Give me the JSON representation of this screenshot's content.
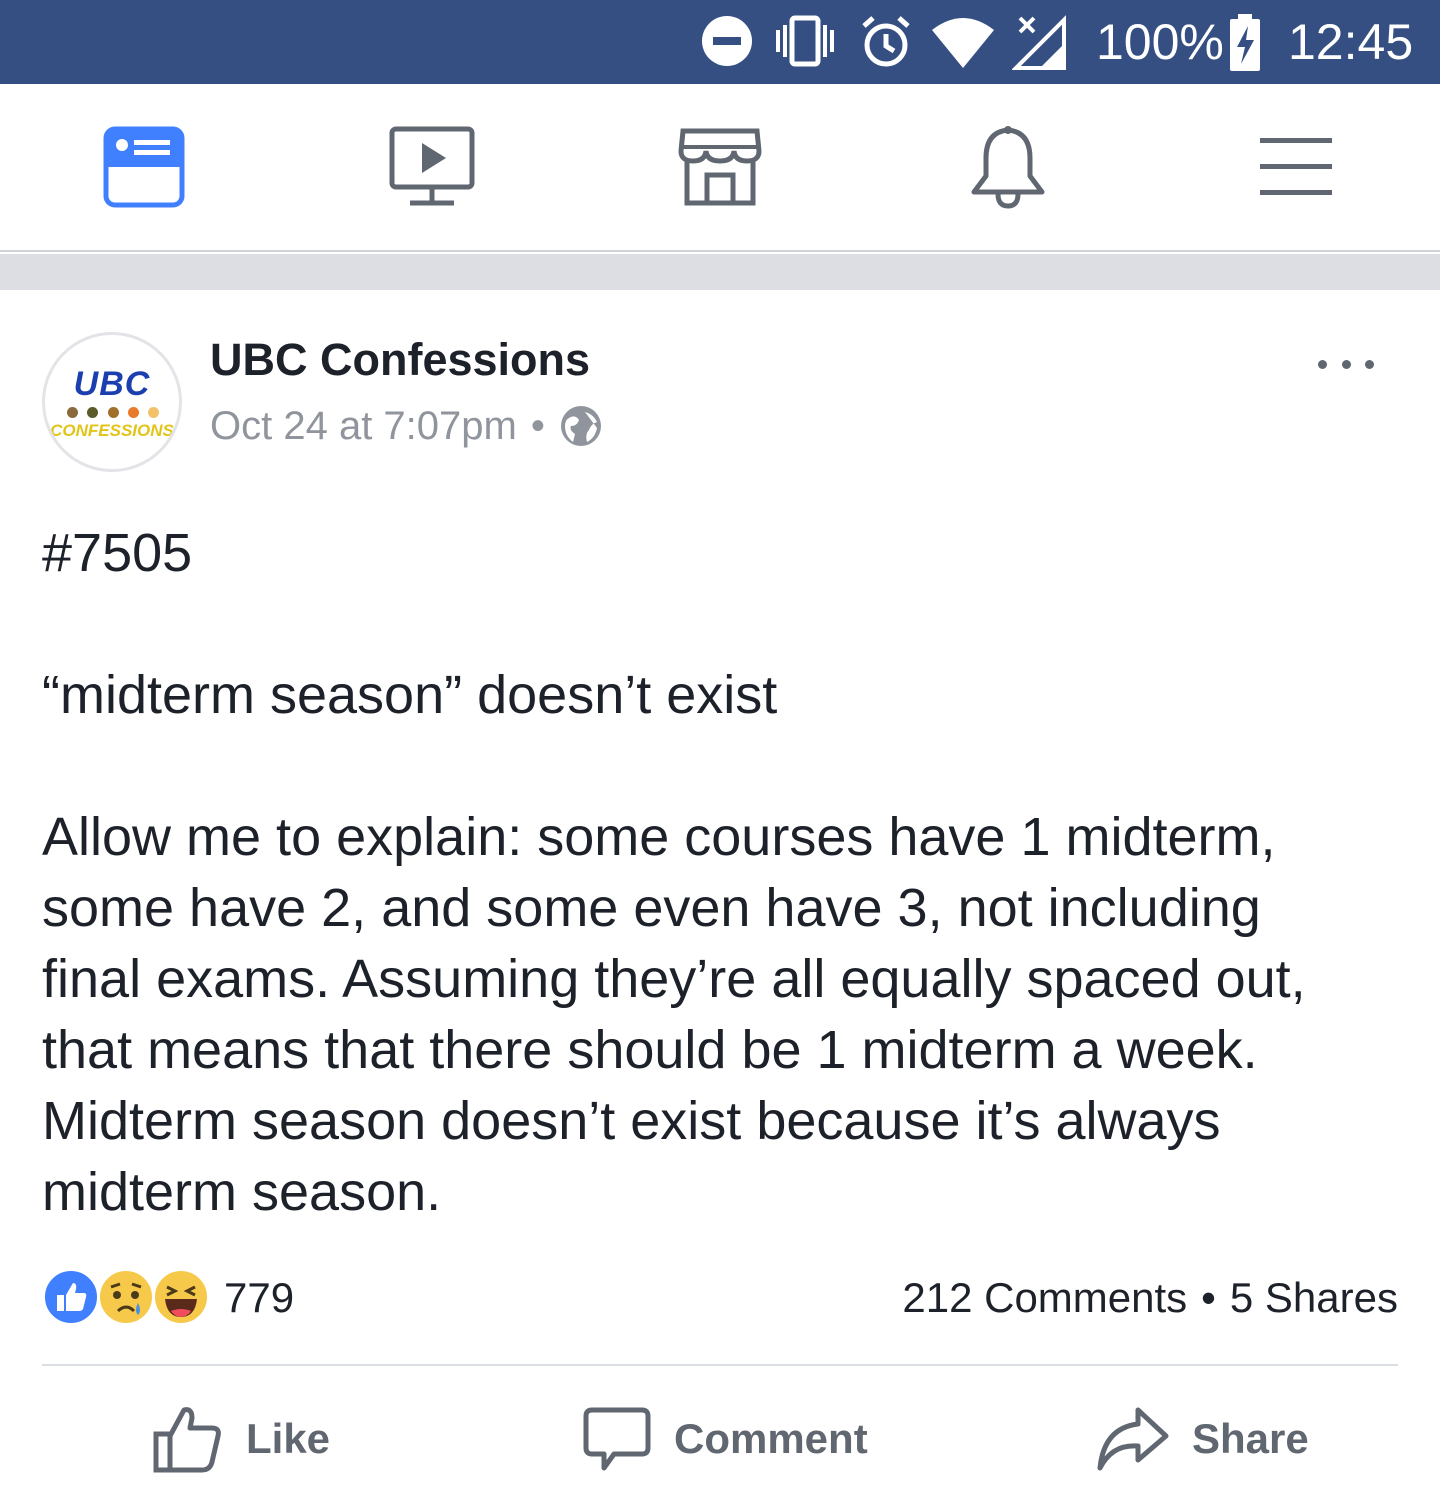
{
  "status_bar": {
    "battery": "100%",
    "time": "12:45",
    "icons": [
      "do-not-disturb-icon",
      "vibrate-icon",
      "alarm-icon",
      "wifi-icon",
      "no-signal-icon",
      "battery-charging-icon"
    ]
  },
  "nav": {
    "tabs": [
      {
        "icon": "news-feed-icon",
        "active": true
      },
      {
        "icon": "watch-video-icon",
        "active": false
      },
      {
        "icon": "marketplace-icon",
        "active": false
      },
      {
        "icon": "notifications-bell-icon",
        "active": false
      },
      {
        "icon": "menu-icon",
        "active": false
      }
    ]
  },
  "post": {
    "avatar": {
      "line1": "UBC",
      "line2": "CONFESSIONS"
    },
    "page_name": "UBC Confessions",
    "timestamp": "Oct 24 at 7:07pm",
    "meta_separator": "•",
    "audience_icon": "globe-icon",
    "body": {
      "number": "#7505",
      "headline": "“midterm season” doesn’t exist",
      "lines": [
        "Allow me to explain: some courses have 1 midterm,",
        "some have 2, and some even have 3, not including",
        "final exams. Assuming they’re all equally spaced out,",
        "that means that there should be 1 midterm a week.",
        "Midterm season doesn’t exist because it’s always",
        "midterm season."
      ]
    },
    "reactions": {
      "icons": [
        "like-reaction-icon",
        "sad-reaction-icon",
        "haha-reaction-icon"
      ],
      "count": "779",
      "comments": "212 Comments",
      "separator": "•",
      "shares": "5 Shares"
    },
    "actions": {
      "like": "Like",
      "comment": "Comment",
      "share": "Share"
    }
  },
  "colors": {
    "status_bar": "#354f82",
    "active_tab": "#4080ff",
    "inactive_icon": "#606770",
    "text": "#1d2129",
    "muted": "#90949c",
    "separator_band": "#dcdee3"
  }
}
